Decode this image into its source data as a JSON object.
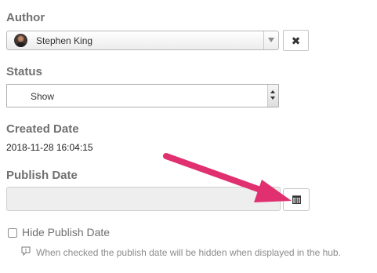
{
  "author": {
    "label": "Author",
    "selected_name": "Stephen King",
    "clear_icon": "close-icon",
    "dropdown_icon": "chevron-down-icon"
  },
  "status": {
    "label": "Status",
    "selected": "Show"
  },
  "created_date": {
    "label": "Created Date",
    "value": "2018-11-28 16:04:15"
  },
  "publish_date": {
    "label": "Publish Date",
    "value": "",
    "calendar_icon": "calendar-icon"
  },
  "hide_publish_date": {
    "label": "Hide Publish Date",
    "checked": false,
    "help_text": "When checked the publish date will be hidden when displayed in the hub.",
    "help_icon": "help-icon"
  },
  "annotation": {
    "color": "#e0306f"
  }
}
